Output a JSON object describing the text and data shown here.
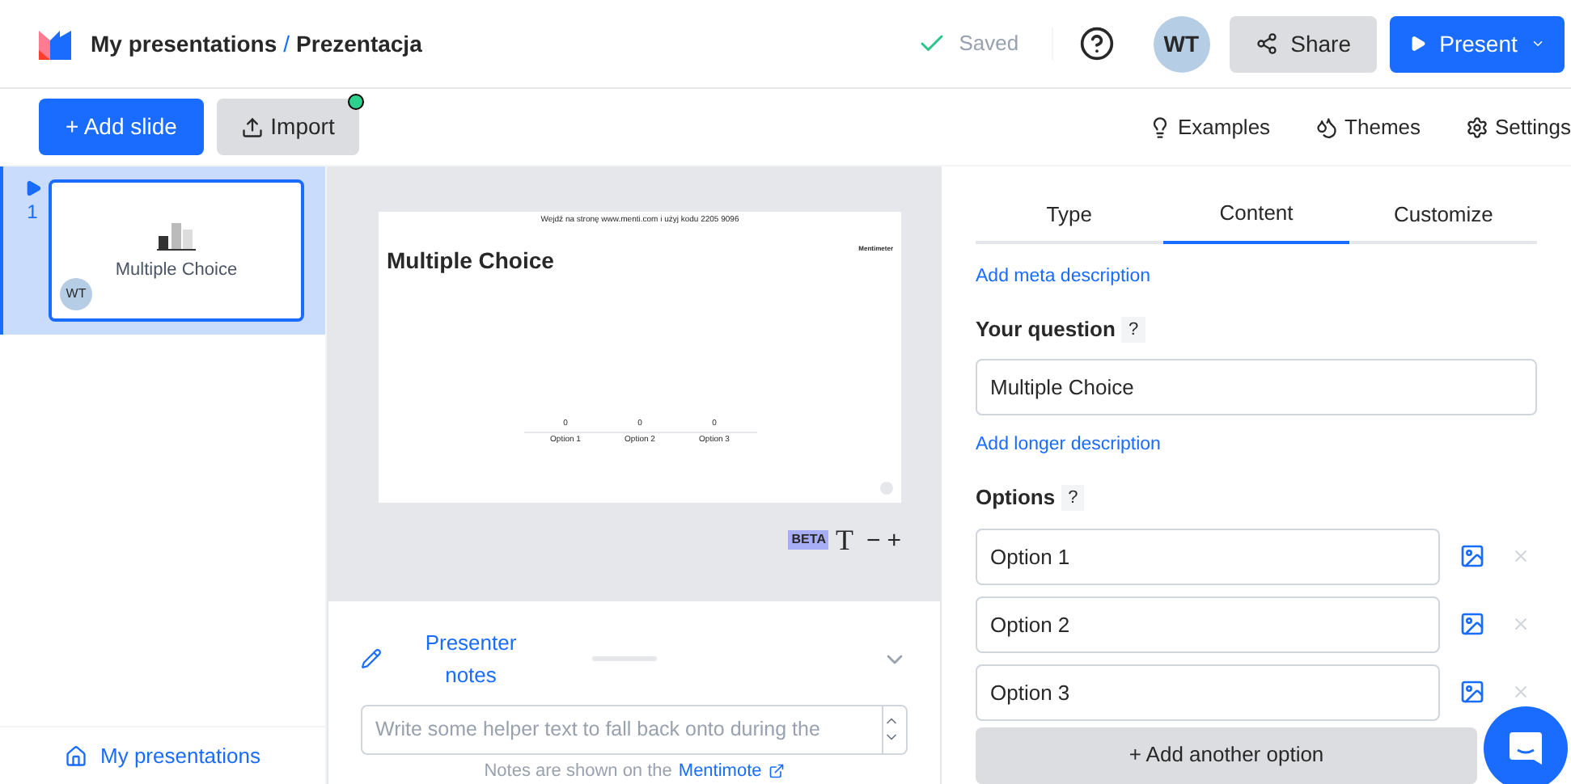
{
  "header": {
    "breadcrumb_parent": "My presentations",
    "separator": "/",
    "title": "Prezentacja",
    "save_status": "Saved",
    "avatar": "WT",
    "share": "Share",
    "present": "Present"
  },
  "toolbar": {
    "add_slide": "+ Add slide",
    "import": "Import",
    "import_badge": true,
    "links": [
      "Examples",
      "Themes",
      "Settings"
    ]
  },
  "slides": [
    {
      "number": "1",
      "title": "Multiple Choice",
      "avatar": "WT",
      "selected": true
    }
  ],
  "sidebar_footer": "My presentations",
  "preview": {
    "join_text": "Wejdź na stronę www.menti.com i użyj kodu 2205 9096",
    "logo": "Mentimeter",
    "title": "Multiple Choice",
    "results": [
      {
        "label": "Option 1",
        "count": "0"
      },
      {
        "label": "Option 2",
        "count": "0"
      },
      {
        "label": "Option 3",
        "count": "0"
      }
    ],
    "beta": "BETA",
    "font_icon": "T",
    "minus": "−",
    "plus": "+"
  },
  "notes": {
    "title": "Presenter notes",
    "placeholder": "Write some helper text to fall back onto during the",
    "footer": "Notes are shown on the",
    "footer_link": "Mentimote",
    "expanded": false
  },
  "tabs": [
    {
      "label": "Type",
      "selected": false
    },
    {
      "label": "Content",
      "selected": true
    },
    {
      "label": "Customize",
      "selected": false
    }
  ],
  "content": {
    "meta_link": "Add meta description",
    "question_label": "Your question",
    "help": "?",
    "question": "Multiple Choice",
    "longer_link": "Add longer description",
    "options_label": "Options",
    "options_help": "?",
    "options": [
      {
        "value": "Option 1"
      },
      {
        "value": "Option 2"
      },
      {
        "value": "Option 3"
      }
    ],
    "add_option": "+ Add another option"
  }
}
